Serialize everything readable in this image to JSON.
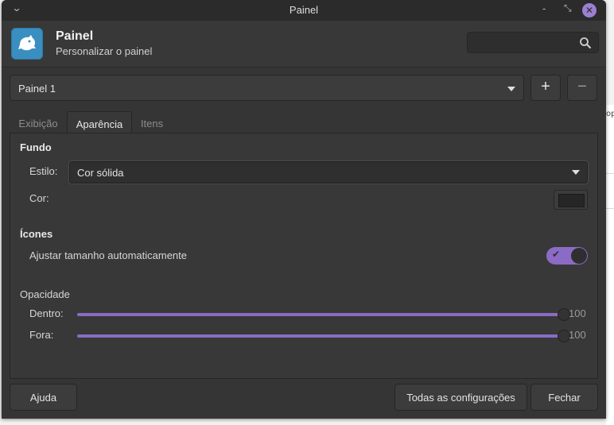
{
  "window": {
    "title": "Painel"
  },
  "header": {
    "title": "Painel",
    "subtitle": "Personalizar o painel",
    "search_placeholder": ""
  },
  "panel_select": {
    "value": "Painel 1",
    "add_label": "+",
    "remove_label": "−"
  },
  "tabs": [
    {
      "label": "Exibição",
      "active": false
    },
    {
      "label": "Aparência",
      "active": true
    },
    {
      "label": "Itens",
      "active": false
    }
  ],
  "fundo": {
    "title": "Fundo",
    "estilo_label": "Estilo:",
    "estilo_value": "Cor sólida",
    "cor_label": "Cor:",
    "cor_value": "#262626"
  },
  "icones": {
    "title": "Ícones",
    "auto_size_label": "Ajustar tamanho automaticamente",
    "auto_size_on": true
  },
  "opacidade": {
    "title": "Opacidade",
    "dentro_label": "Dentro:",
    "dentro_value": 100,
    "dentro_text": "100",
    "fora_label": "Fora:",
    "fora_value": 100,
    "fora_text": "100"
  },
  "footer": {
    "help": "Ajuda",
    "all_settings": "Todas as configurações",
    "close": "Fechar"
  },
  "background_peek": {
    "text": "op"
  },
  "colors": {
    "accent": "#8b6bc5",
    "close_button": "#9b7fd1",
    "app_icon": "#3a8ec0"
  }
}
